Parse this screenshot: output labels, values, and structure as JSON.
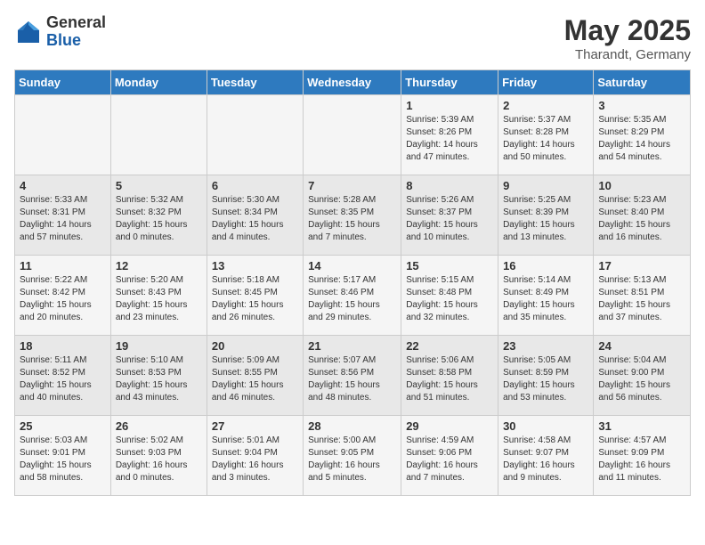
{
  "header": {
    "logo_general": "General",
    "logo_blue": "Blue",
    "month": "May 2025",
    "location": "Tharandt, Germany"
  },
  "weekdays": [
    "Sunday",
    "Monday",
    "Tuesday",
    "Wednesday",
    "Thursday",
    "Friday",
    "Saturday"
  ],
  "weeks": [
    [
      {
        "day": "",
        "detail": ""
      },
      {
        "day": "",
        "detail": ""
      },
      {
        "day": "",
        "detail": ""
      },
      {
        "day": "",
        "detail": ""
      },
      {
        "day": "1",
        "detail": "Sunrise: 5:39 AM\nSunset: 8:26 PM\nDaylight: 14 hours\nand 47 minutes."
      },
      {
        "day": "2",
        "detail": "Sunrise: 5:37 AM\nSunset: 8:28 PM\nDaylight: 14 hours\nand 50 minutes."
      },
      {
        "day": "3",
        "detail": "Sunrise: 5:35 AM\nSunset: 8:29 PM\nDaylight: 14 hours\nand 54 minutes."
      }
    ],
    [
      {
        "day": "4",
        "detail": "Sunrise: 5:33 AM\nSunset: 8:31 PM\nDaylight: 14 hours\nand 57 minutes."
      },
      {
        "day": "5",
        "detail": "Sunrise: 5:32 AM\nSunset: 8:32 PM\nDaylight: 15 hours\nand 0 minutes."
      },
      {
        "day": "6",
        "detail": "Sunrise: 5:30 AM\nSunset: 8:34 PM\nDaylight: 15 hours\nand 4 minutes."
      },
      {
        "day": "7",
        "detail": "Sunrise: 5:28 AM\nSunset: 8:35 PM\nDaylight: 15 hours\nand 7 minutes."
      },
      {
        "day": "8",
        "detail": "Sunrise: 5:26 AM\nSunset: 8:37 PM\nDaylight: 15 hours\nand 10 minutes."
      },
      {
        "day": "9",
        "detail": "Sunrise: 5:25 AM\nSunset: 8:39 PM\nDaylight: 15 hours\nand 13 minutes."
      },
      {
        "day": "10",
        "detail": "Sunrise: 5:23 AM\nSunset: 8:40 PM\nDaylight: 15 hours\nand 16 minutes."
      }
    ],
    [
      {
        "day": "11",
        "detail": "Sunrise: 5:22 AM\nSunset: 8:42 PM\nDaylight: 15 hours\nand 20 minutes."
      },
      {
        "day": "12",
        "detail": "Sunrise: 5:20 AM\nSunset: 8:43 PM\nDaylight: 15 hours\nand 23 minutes."
      },
      {
        "day": "13",
        "detail": "Sunrise: 5:18 AM\nSunset: 8:45 PM\nDaylight: 15 hours\nand 26 minutes."
      },
      {
        "day": "14",
        "detail": "Sunrise: 5:17 AM\nSunset: 8:46 PM\nDaylight: 15 hours\nand 29 minutes."
      },
      {
        "day": "15",
        "detail": "Sunrise: 5:15 AM\nSunset: 8:48 PM\nDaylight: 15 hours\nand 32 minutes."
      },
      {
        "day": "16",
        "detail": "Sunrise: 5:14 AM\nSunset: 8:49 PM\nDaylight: 15 hours\nand 35 minutes."
      },
      {
        "day": "17",
        "detail": "Sunrise: 5:13 AM\nSunset: 8:51 PM\nDaylight: 15 hours\nand 37 minutes."
      }
    ],
    [
      {
        "day": "18",
        "detail": "Sunrise: 5:11 AM\nSunset: 8:52 PM\nDaylight: 15 hours\nand 40 minutes."
      },
      {
        "day": "19",
        "detail": "Sunrise: 5:10 AM\nSunset: 8:53 PM\nDaylight: 15 hours\nand 43 minutes."
      },
      {
        "day": "20",
        "detail": "Sunrise: 5:09 AM\nSunset: 8:55 PM\nDaylight: 15 hours\nand 46 minutes."
      },
      {
        "day": "21",
        "detail": "Sunrise: 5:07 AM\nSunset: 8:56 PM\nDaylight: 15 hours\nand 48 minutes."
      },
      {
        "day": "22",
        "detail": "Sunrise: 5:06 AM\nSunset: 8:58 PM\nDaylight: 15 hours\nand 51 minutes."
      },
      {
        "day": "23",
        "detail": "Sunrise: 5:05 AM\nSunset: 8:59 PM\nDaylight: 15 hours\nand 53 minutes."
      },
      {
        "day": "24",
        "detail": "Sunrise: 5:04 AM\nSunset: 9:00 PM\nDaylight: 15 hours\nand 56 minutes."
      }
    ],
    [
      {
        "day": "25",
        "detail": "Sunrise: 5:03 AM\nSunset: 9:01 PM\nDaylight: 15 hours\nand 58 minutes."
      },
      {
        "day": "26",
        "detail": "Sunrise: 5:02 AM\nSunset: 9:03 PM\nDaylight: 16 hours\nand 0 minutes."
      },
      {
        "day": "27",
        "detail": "Sunrise: 5:01 AM\nSunset: 9:04 PM\nDaylight: 16 hours\nand 3 minutes."
      },
      {
        "day": "28",
        "detail": "Sunrise: 5:00 AM\nSunset: 9:05 PM\nDaylight: 16 hours\nand 5 minutes."
      },
      {
        "day": "29",
        "detail": "Sunrise: 4:59 AM\nSunset: 9:06 PM\nDaylight: 16 hours\nand 7 minutes."
      },
      {
        "day": "30",
        "detail": "Sunrise: 4:58 AM\nSunset: 9:07 PM\nDaylight: 16 hours\nand 9 minutes."
      },
      {
        "day": "31",
        "detail": "Sunrise: 4:57 AM\nSunset: 9:09 PM\nDaylight: 16 hours\nand 11 minutes."
      }
    ]
  ]
}
